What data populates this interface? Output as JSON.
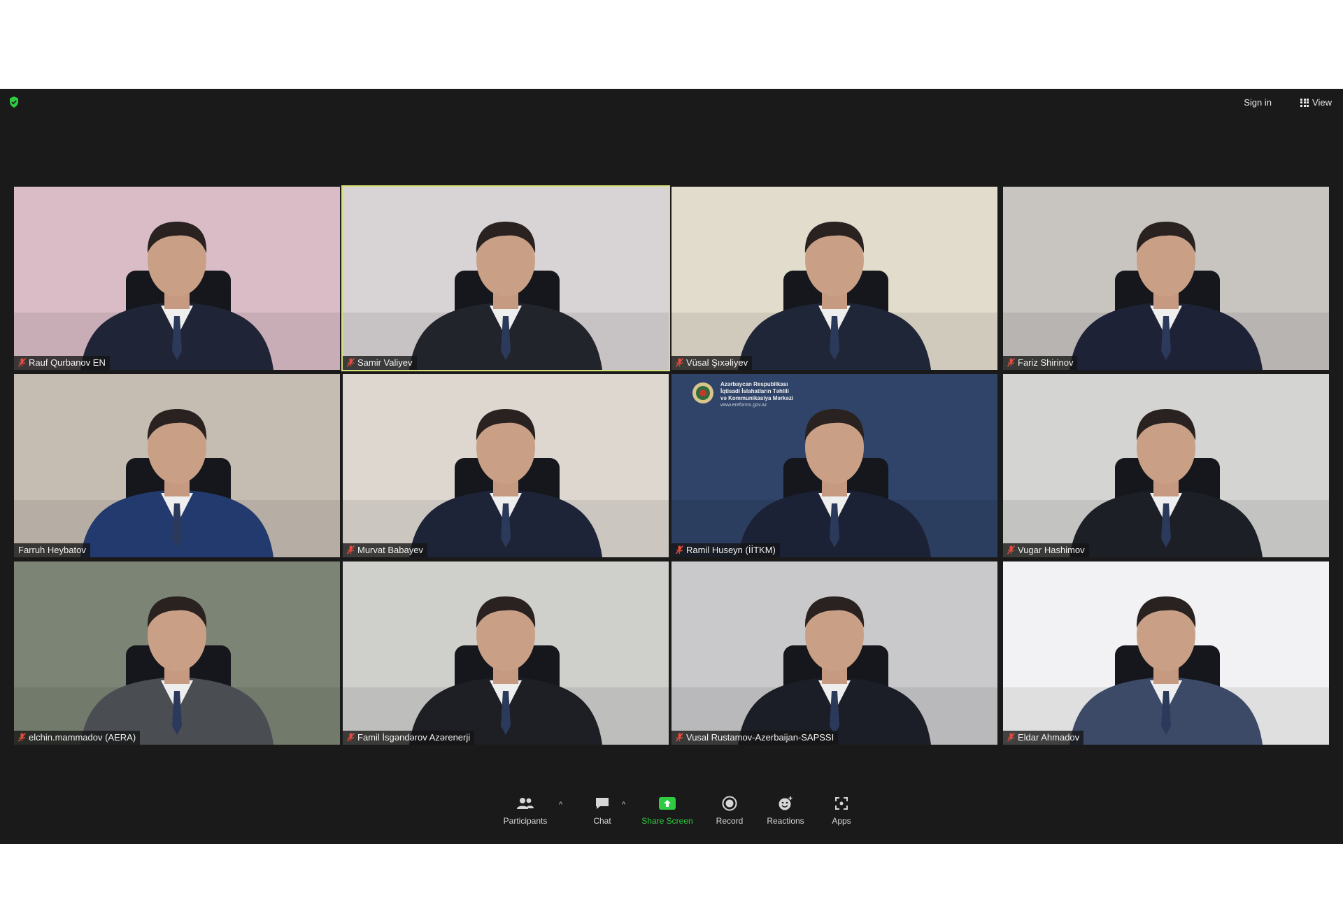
{
  "header": {
    "sign_in_label": "Sign in",
    "view_label": "View",
    "security_icon": "shield-check-icon",
    "security_color": "#2ecc40"
  },
  "participants": [
    {
      "name": "Rauf Qurbanov EN",
      "muted": true,
      "active": false,
      "bg": "#d9bcc6",
      "suit": "#1f2436"
    },
    {
      "name": "Samir Valiyev",
      "muted": true,
      "active": true,
      "bg": "#d8d4d6",
      "suit": "#22242c"
    },
    {
      "name": "Vüsal Şıxəliyev",
      "muted": true,
      "active": false,
      "bg": "#e2dccd",
      "suit": "#1f2638"
    },
    {
      "name": "Fariz Shirinov",
      "muted": true,
      "active": false,
      "bg": "#c8c4c0",
      "suit": "#1e2236"
    },
    {
      "name": "Farruh Heybatov",
      "muted": false,
      "active": false,
      "bg": "#c6bdb2",
      "suit": "#233a6e"
    },
    {
      "name": "Murvat Babayev",
      "muted": true,
      "active": false,
      "bg": "#ddd7d0",
      "suit": "#1e2438"
    },
    {
      "name": "Ramil Huseyn (İİTKM)",
      "muted": true,
      "active": false,
      "bg": "#2f4468",
      "suit": "#1c2236"
    },
    {
      "name": "Vugar Hashimov",
      "muted": true,
      "active": false,
      "bg": "#d4d4d2",
      "suit": "#1c1f26"
    },
    {
      "name": "elchin.mammadov (AERA)",
      "muted": true,
      "active": false,
      "bg": "#7c8575",
      "suit": "#4a4d52"
    },
    {
      "name": "Famil İsgəndərov Azərenerji",
      "muted": true,
      "active": false,
      "bg": "#cfd0cc",
      "suit": "#1d1f24"
    },
    {
      "name": "Vusal Rustamov-Azerbaijan-SAPSSI",
      "muted": true,
      "active": false,
      "bg": "#c9c9cb",
      "suit": "#1b1e26"
    },
    {
      "name": "Eldar Ahmadov",
      "muted": true,
      "active": false,
      "bg": "#f2f2f4",
      "suit": "#3c4a68"
    }
  ],
  "tile7_logo": {
    "line1": "Azərbaycan Respublikası",
    "line2": "İqtisadi İslahatların Təhlili",
    "line3": "və Kommunikasiya Mərkəzi",
    "line4": "www.ereforms.gov.az"
  },
  "toolbar": {
    "participants_label": "Participants",
    "chat_label": "Chat",
    "share_label": "Share Screen",
    "record_label": "Record",
    "reactions_label": "Reactions",
    "apps_label": "Apps",
    "share_color": "#2ecc40"
  }
}
